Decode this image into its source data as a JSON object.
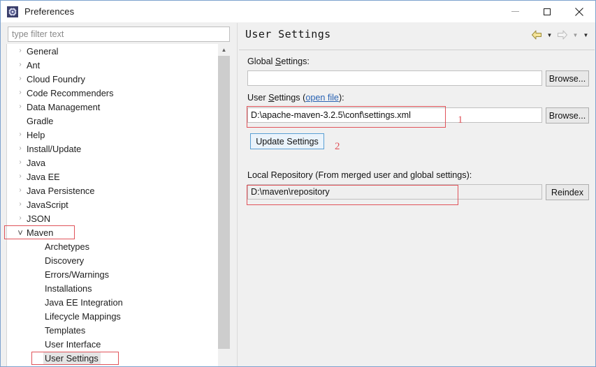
{
  "window": {
    "title": "Preferences",
    "icon": "gear-icon",
    "minimize_label": "Minimize",
    "maximize_label": "Maximize",
    "close_label": "Close"
  },
  "filter": {
    "placeholder": "type filter text",
    "value": ""
  },
  "tree": {
    "items": [
      {
        "label": "General",
        "level": 0,
        "expandable": true,
        "expanded": false
      },
      {
        "label": "Ant",
        "level": 0,
        "expandable": true,
        "expanded": false
      },
      {
        "label": "Cloud Foundry",
        "level": 0,
        "expandable": true,
        "expanded": false
      },
      {
        "label": "Code Recommenders",
        "level": 0,
        "expandable": true,
        "expanded": false
      },
      {
        "label": "Data Management",
        "level": 0,
        "expandable": true,
        "expanded": false
      },
      {
        "label": "Gradle",
        "level": 0,
        "expandable": false,
        "expanded": false
      },
      {
        "label": "Help",
        "level": 0,
        "expandable": true,
        "expanded": false
      },
      {
        "label": "Install/Update",
        "level": 0,
        "expandable": true,
        "expanded": false
      },
      {
        "label": "Java",
        "level": 0,
        "expandable": true,
        "expanded": false
      },
      {
        "label": "Java EE",
        "level": 0,
        "expandable": true,
        "expanded": false
      },
      {
        "label": "Java Persistence",
        "level": 0,
        "expandable": true,
        "expanded": false
      },
      {
        "label": "JavaScript",
        "level": 0,
        "expandable": true,
        "expanded": false
      },
      {
        "label": "JSON",
        "level": 0,
        "expandable": true,
        "expanded": false
      },
      {
        "label": "Maven",
        "level": 0,
        "expandable": true,
        "expanded": true,
        "annotated": true
      },
      {
        "label": "Archetypes",
        "level": 1,
        "expandable": false,
        "expanded": false
      },
      {
        "label": "Discovery",
        "level": 1,
        "expandable": false,
        "expanded": false
      },
      {
        "label": "Errors/Warnings",
        "level": 1,
        "expandable": false,
        "expanded": false
      },
      {
        "label": "Installations",
        "level": 1,
        "expandable": false,
        "expanded": false
      },
      {
        "label": "Java EE Integration",
        "level": 1,
        "expandable": false,
        "expanded": false
      },
      {
        "label": "Lifecycle Mappings",
        "level": 1,
        "expandable": false,
        "expanded": false
      },
      {
        "label": "Templates",
        "level": 1,
        "expandable": false,
        "expanded": false
      },
      {
        "label": "User Interface",
        "level": 1,
        "expandable": false,
        "expanded": false
      },
      {
        "label": "User Settings",
        "level": 1,
        "expandable": false,
        "expanded": false,
        "selected": true,
        "annotated": true
      }
    ],
    "chevron_collapsed": "›",
    "chevron_expanded": "˅",
    "scrollbar": {
      "up_glyph": "▲",
      "down_glyph": "▼"
    }
  },
  "page": {
    "title": "User Settings",
    "nav": {
      "back_icon": "back-arrow-icon",
      "back_caret_icon": "chevron-down-icon",
      "forward_icon": "forward-arrow-icon",
      "forward_caret_icon": "chevron-down-icon",
      "menu_caret_icon": "chevron-down-icon",
      "caret_glyph": "▼"
    },
    "global_settings": {
      "label_pre": "Global ",
      "label_mnemonic": "S",
      "label_post": "ettings:",
      "value": "",
      "browse_label": "Browse..."
    },
    "user_settings": {
      "label_pre": "User ",
      "label_mnemonic": "S",
      "label_mid": "ettings (",
      "link_label": "open file",
      "label_post": "):",
      "value": "D:\\apache-maven-3.2.5\\conf\\settings.xml",
      "browse_label": "Browse...",
      "update_label": "Update Settings"
    },
    "local_repository": {
      "label": "Local Repository (From merged user and global settings):",
      "value": "D:\\maven\\repository",
      "reindex_label": "Reindex"
    }
  },
  "annotations": {
    "color": "#e0535a",
    "marker_one": "1",
    "marker_two": "2"
  }
}
